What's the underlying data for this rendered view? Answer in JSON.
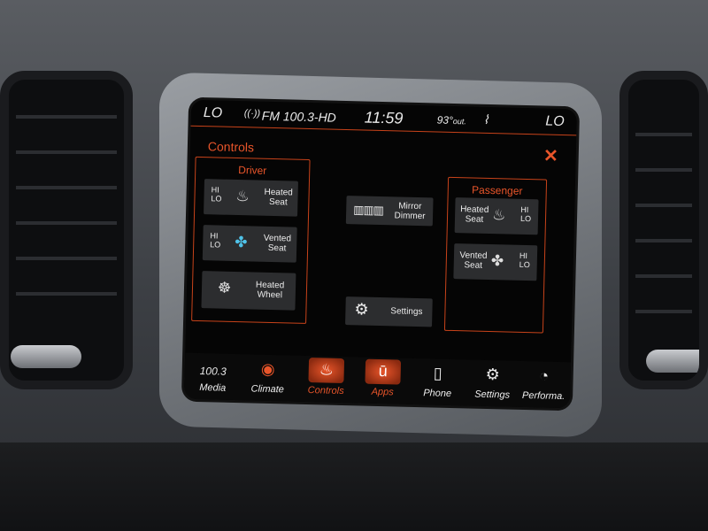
{
  "status_bar": {
    "left_temp_setting": "LO",
    "right_temp_setting": "LO",
    "radio_station": "FM 100.3-HD",
    "clock": "11:59",
    "outside_temp": "93°",
    "outside_temp_suffix": "out."
  },
  "page": {
    "title": "Controls"
  },
  "driver": {
    "title": "Driver",
    "heated_seat": {
      "hi": "HI",
      "lo": "LO",
      "label_1": "Heated",
      "label_2": "Seat"
    },
    "vented_seat": {
      "hi": "HI",
      "lo": "LO",
      "label_1": "Vented",
      "label_2": "Seat"
    },
    "heated_wheel": {
      "label_1": "Heated",
      "label_2": "Wheel"
    }
  },
  "center": {
    "mirror": {
      "label_1": "Mirror",
      "label_2": "Dimmer"
    },
    "settings": {
      "label": "Settings"
    }
  },
  "passenger": {
    "title": "Passenger",
    "heated_seat": {
      "hi": "HI",
      "lo": "LO",
      "label_1": "Heated",
      "label_2": "Seat"
    },
    "vented_seat": {
      "hi": "HI",
      "lo": "LO",
      "label_1": "Vented",
      "label_2": "Seat"
    }
  },
  "nav": {
    "media_value": "100.3",
    "media": "Media",
    "climate": "Climate",
    "controls": "Controls",
    "apps": "Apps",
    "apps_icon_glyph": "ū",
    "phone": "Phone",
    "settings": "Settings",
    "performance": "Performa."
  },
  "colors": {
    "accent": "#e8552a",
    "vented_icon": "#4fc2e8",
    "button_bg": "#2c2d2f"
  }
}
